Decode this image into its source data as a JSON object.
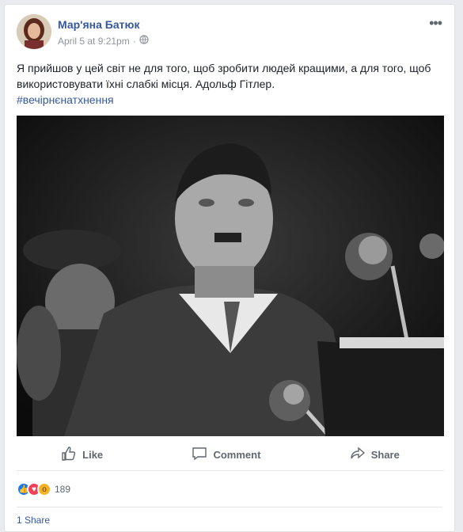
{
  "post": {
    "author": "Мар'яна Батюк",
    "timestamp": "April 5 at 9:21pm",
    "separator": "·",
    "privacy_icon": "globe-icon",
    "more_label": "•••",
    "text": "Я прийшов у цей світ не для того, щоб зробити людей кращими, а для того, щоб використовувати їхні слабкі місця. Адольф Гітлер.",
    "hashtag": "#вечірнєнатхнення"
  },
  "actions": {
    "like": "Like",
    "comment": "Comment",
    "share": "Share"
  },
  "reactions": {
    "icons": [
      "like-reaction-icon",
      "love-reaction-icon",
      "wow-reaction-icon"
    ],
    "colors": {
      "like": "#1877f2",
      "love": "#f33e58",
      "wow": "#f7b125"
    },
    "count": "189"
  },
  "shares": "1 Share"
}
